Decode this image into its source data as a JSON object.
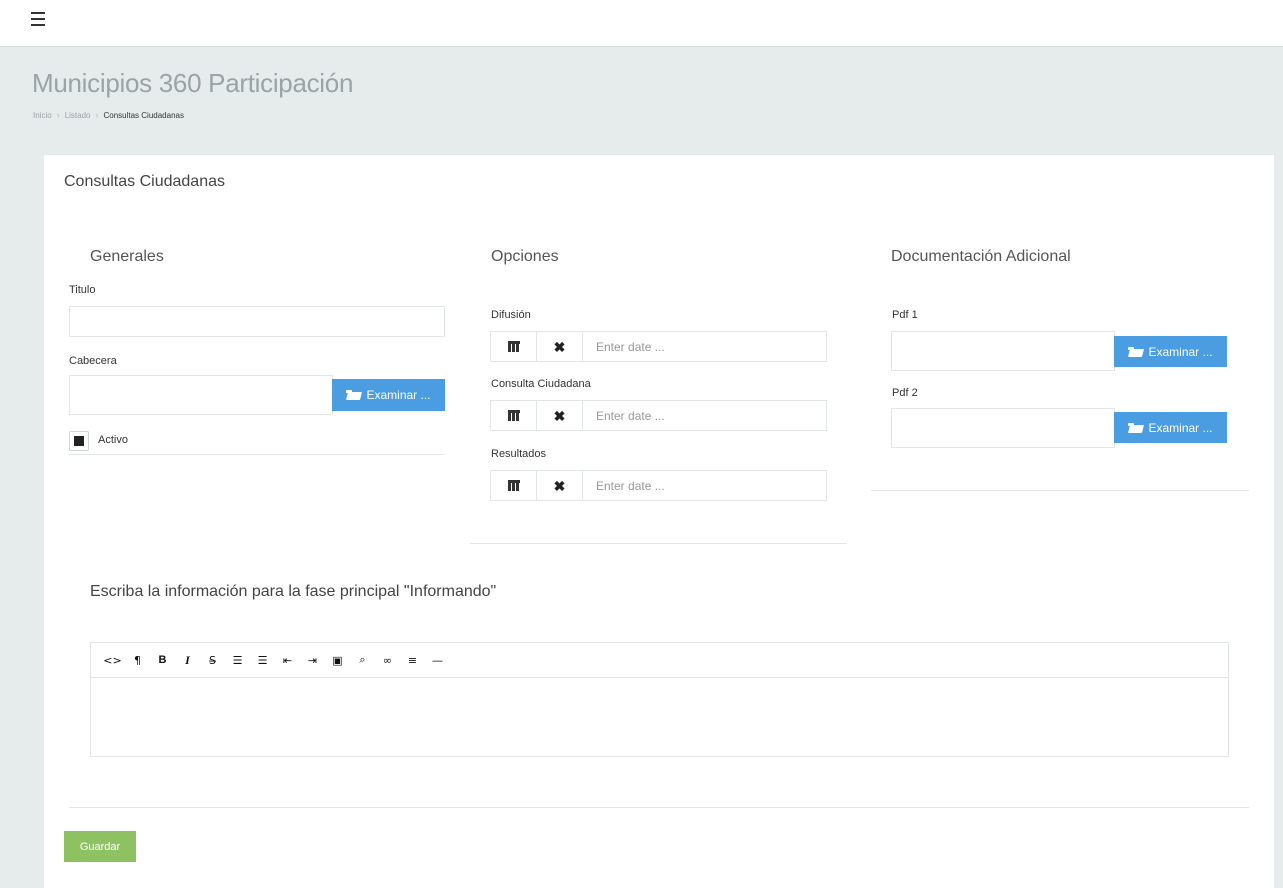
{
  "app": {
    "title": "Municipios 360 Participación",
    "breadcrumb": [
      "Inicio",
      "Listado",
      "Consultas Ciudadanas"
    ]
  },
  "card": {
    "title": "Consultas Ciudadanas"
  },
  "generales": {
    "title": "Generales",
    "titulo_label": "Titulo",
    "titulo_value": "",
    "cabecera_label": "Cabecera",
    "cabecera_value": "",
    "browse_label": "Examinar ...",
    "activo_label": "Activo",
    "activo_checked": true
  },
  "opciones": {
    "title": "Opciones",
    "fields": [
      {
        "label": "Difusión",
        "placeholder": "Enter date ..."
      },
      {
        "label": "Consulta Ciudadana",
        "placeholder": "Enter date ..."
      },
      {
        "label": "Resultados",
        "placeholder": "Enter date ..."
      }
    ]
  },
  "documentacion": {
    "title": "Documentación Adicional",
    "pdf1_label": "Pdf 1",
    "pdf2_label": "Pdf 2",
    "browse_label": "Examinar ..."
  },
  "editor": {
    "instruction": "Escriba la información para la fase principal \"Informando\"",
    "toolbar": [
      {
        "name": "code-view-icon",
        "glyph": "<>"
      },
      {
        "name": "paragraph-icon",
        "glyph": "¶"
      },
      {
        "name": "bold-icon",
        "glyph": "B"
      },
      {
        "name": "italic-icon",
        "glyph": "I"
      },
      {
        "name": "strikethrough-icon",
        "glyph": "S̶"
      },
      {
        "name": "unordered-list-icon",
        "glyph": "☰"
      },
      {
        "name": "ordered-list-icon",
        "glyph": "☰"
      },
      {
        "name": "outdent-icon",
        "glyph": "⇤"
      },
      {
        "name": "indent-icon",
        "glyph": "⇥"
      },
      {
        "name": "image-icon",
        "glyph": "▣"
      },
      {
        "name": "attach-icon",
        "glyph": "⌕"
      },
      {
        "name": "link-icon",
        "glyph": "∞"
      },
      {
        "name": "align-icon",
        "glyph": "≡"
      },
      {
        "name": "horizontal-rule-icon",
        "glyph": "—"
      }
    ]
  },
  "actions": {
    "save_label": "Guardar"
  },
  "colors": {
    "primary_button": "#4a9de0",
    "save_button": "#8dc162",
    "page_background": "#e6ecec"
  }
}
